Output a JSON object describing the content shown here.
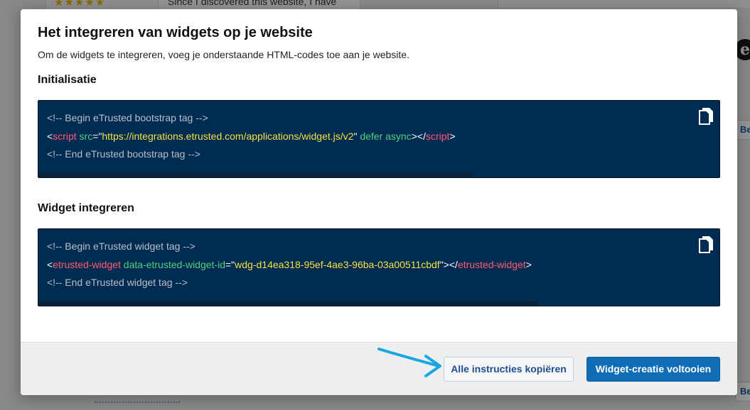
{
  "background": {
    "stars": "★★★★★",
    "review_snippet": "Since I discovered this website, I have",
    "logo_letter": "e",
    "side_button_label": "Be"
  },
  "modal": {
    "title": "Het integreren van widgets op je website",
    "subtitle": "Om de widgets te integreren, voeg je onderstaande HTML-codes toe aan je website.",
    "sections": [
      {
        "title": "Initialisatie",
        "comment_begin": "<!-- Begin eTrusted bootstrap tag -->",
        "tag_open_bracket": "<",
        "tag_name": "script",
        "attr1": "src",
        "eq": "=",
        "quote": "\"",
        "value1": "https://integrations.etrusted.com/applications/widget.js/v2",
        "attr2": "defer async",
        "close_bracket": ">",
        "end_open": "</",
        "end_close": ">",
        "comment_end": "<!-- End eTrusted bootstrap tag -->"
      },
      {
        "title": "Widget integreren",
        "comment_begin": "<!-- Begin eTrusted widget tag -->",
        "tag_open_bracket": "<",
        "tag_name": "etrusted-widget",
        "attr1": "data-etrusted-widget-id",
        "eq": "=",
        "quote": "\"",
        "value1": "wdg-d14ea318-95ef-4ae3-96ba-03a00511cbdf",
        "close_bracket": ">",
        "end_open": "</",
        "end_close": ">",
        "comment_end": "<!-- End eTrusted widget tag -->"
      }
    ],
    "footer": {
      "copy_all_label": "Alle instructies kopiëren",
      "finish_label": "Widget-creatie voltooien"
    }
  },
  "colors": {
    "code_bg": "#002b52",
    "tag": "#ff5d6c",
    "attribute": "#4fd17b",
    "string": "#f5e23e",
    "primary_button": "#0f6db8",
    "arrow": "#1aa7e0"
  },
  "icons": {
    "copy": "copy-icon",
    "arrow": "arrow-annotation"
  }
}
